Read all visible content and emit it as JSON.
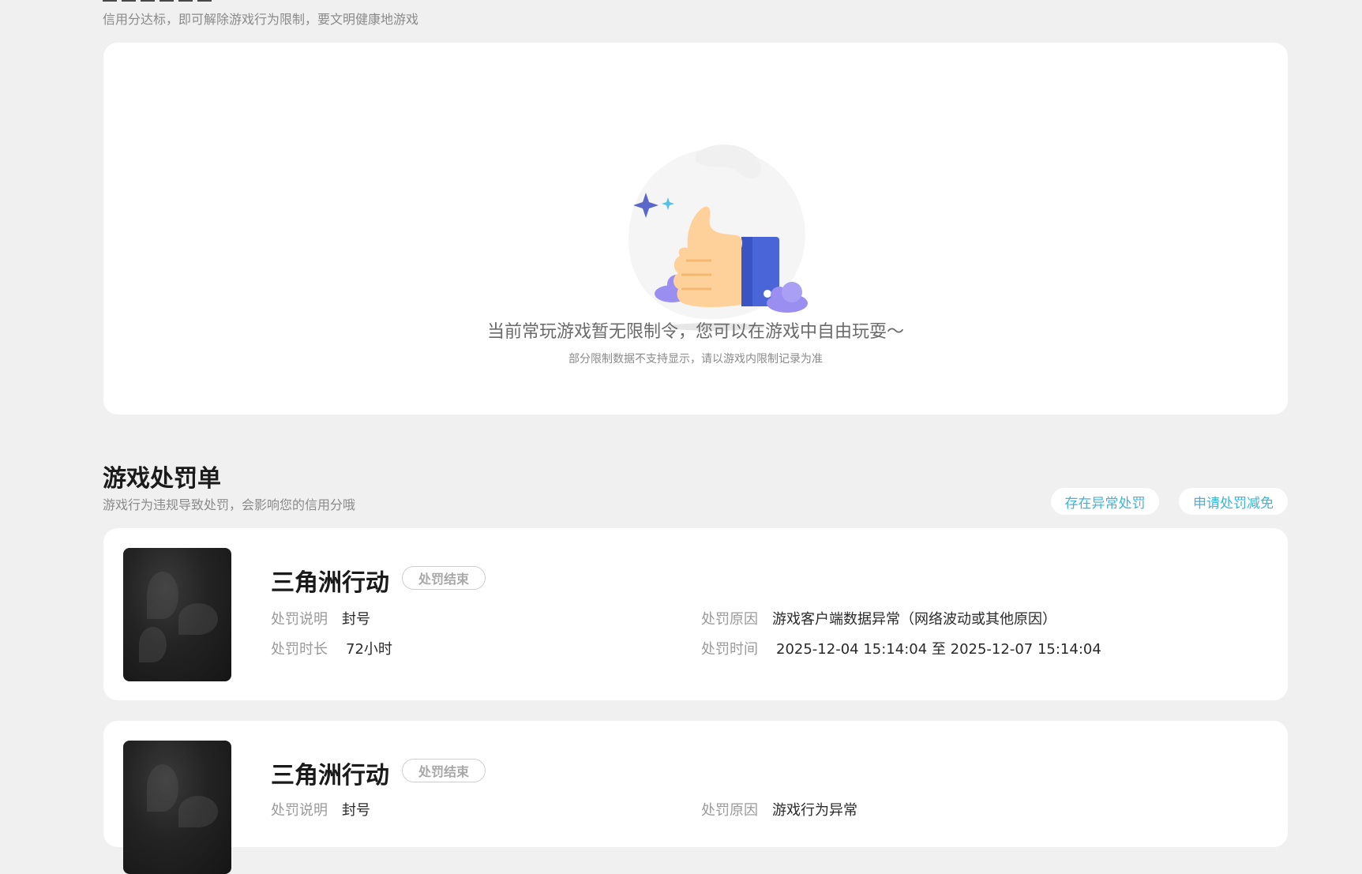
{
  "restriction": {
    "subtitle": "信用分达标，即可解除游戏行为限制，要文明健康地游戏",
    "empty_title": "当前常玩游戏暂无限制令，您可以在游戏中自由玩耍～",
    "empty_note": "部分限制数据不支持显示，请以游戏内限制记录为准",
    "illustration_icon": "thumbs-up-icon"
  },
  "penalty": {
    "title": "游戏处罚单",
    "subtitle": "游戏行为违规导致处罚，会影响您的信用分哦",
    "btn_abnormal": "存在异常处罚",
    "btn_reduce": "申请处罚减免",
    "accent": "#3fb3d8",
    "items": [
      {
        "game": "三角洲行动",
        "status": "处罚结束",
        "desc_label": "处罚说明",
        "desc": "封号",
        "reason_label": "处罚原因",
        "reason": "游戏客户端数据异常（网络波动或其他原因）",
        "duration_label": "处罚时长",
        "duration": "72小时",
        "time_label": "处罚时间",
        "time": "2025-12-04 15:14:04 至 2025-12-07 15:14:04"
      },
      {
        "game": "三角洲行动",
        "status": "处罚结束",
        "desc_label": "处罚说明",
        "desc": "封号",
        "reason_label": "处罚原因",
        "reason": "游戏行为异常"
      }
    ]
  }
}
